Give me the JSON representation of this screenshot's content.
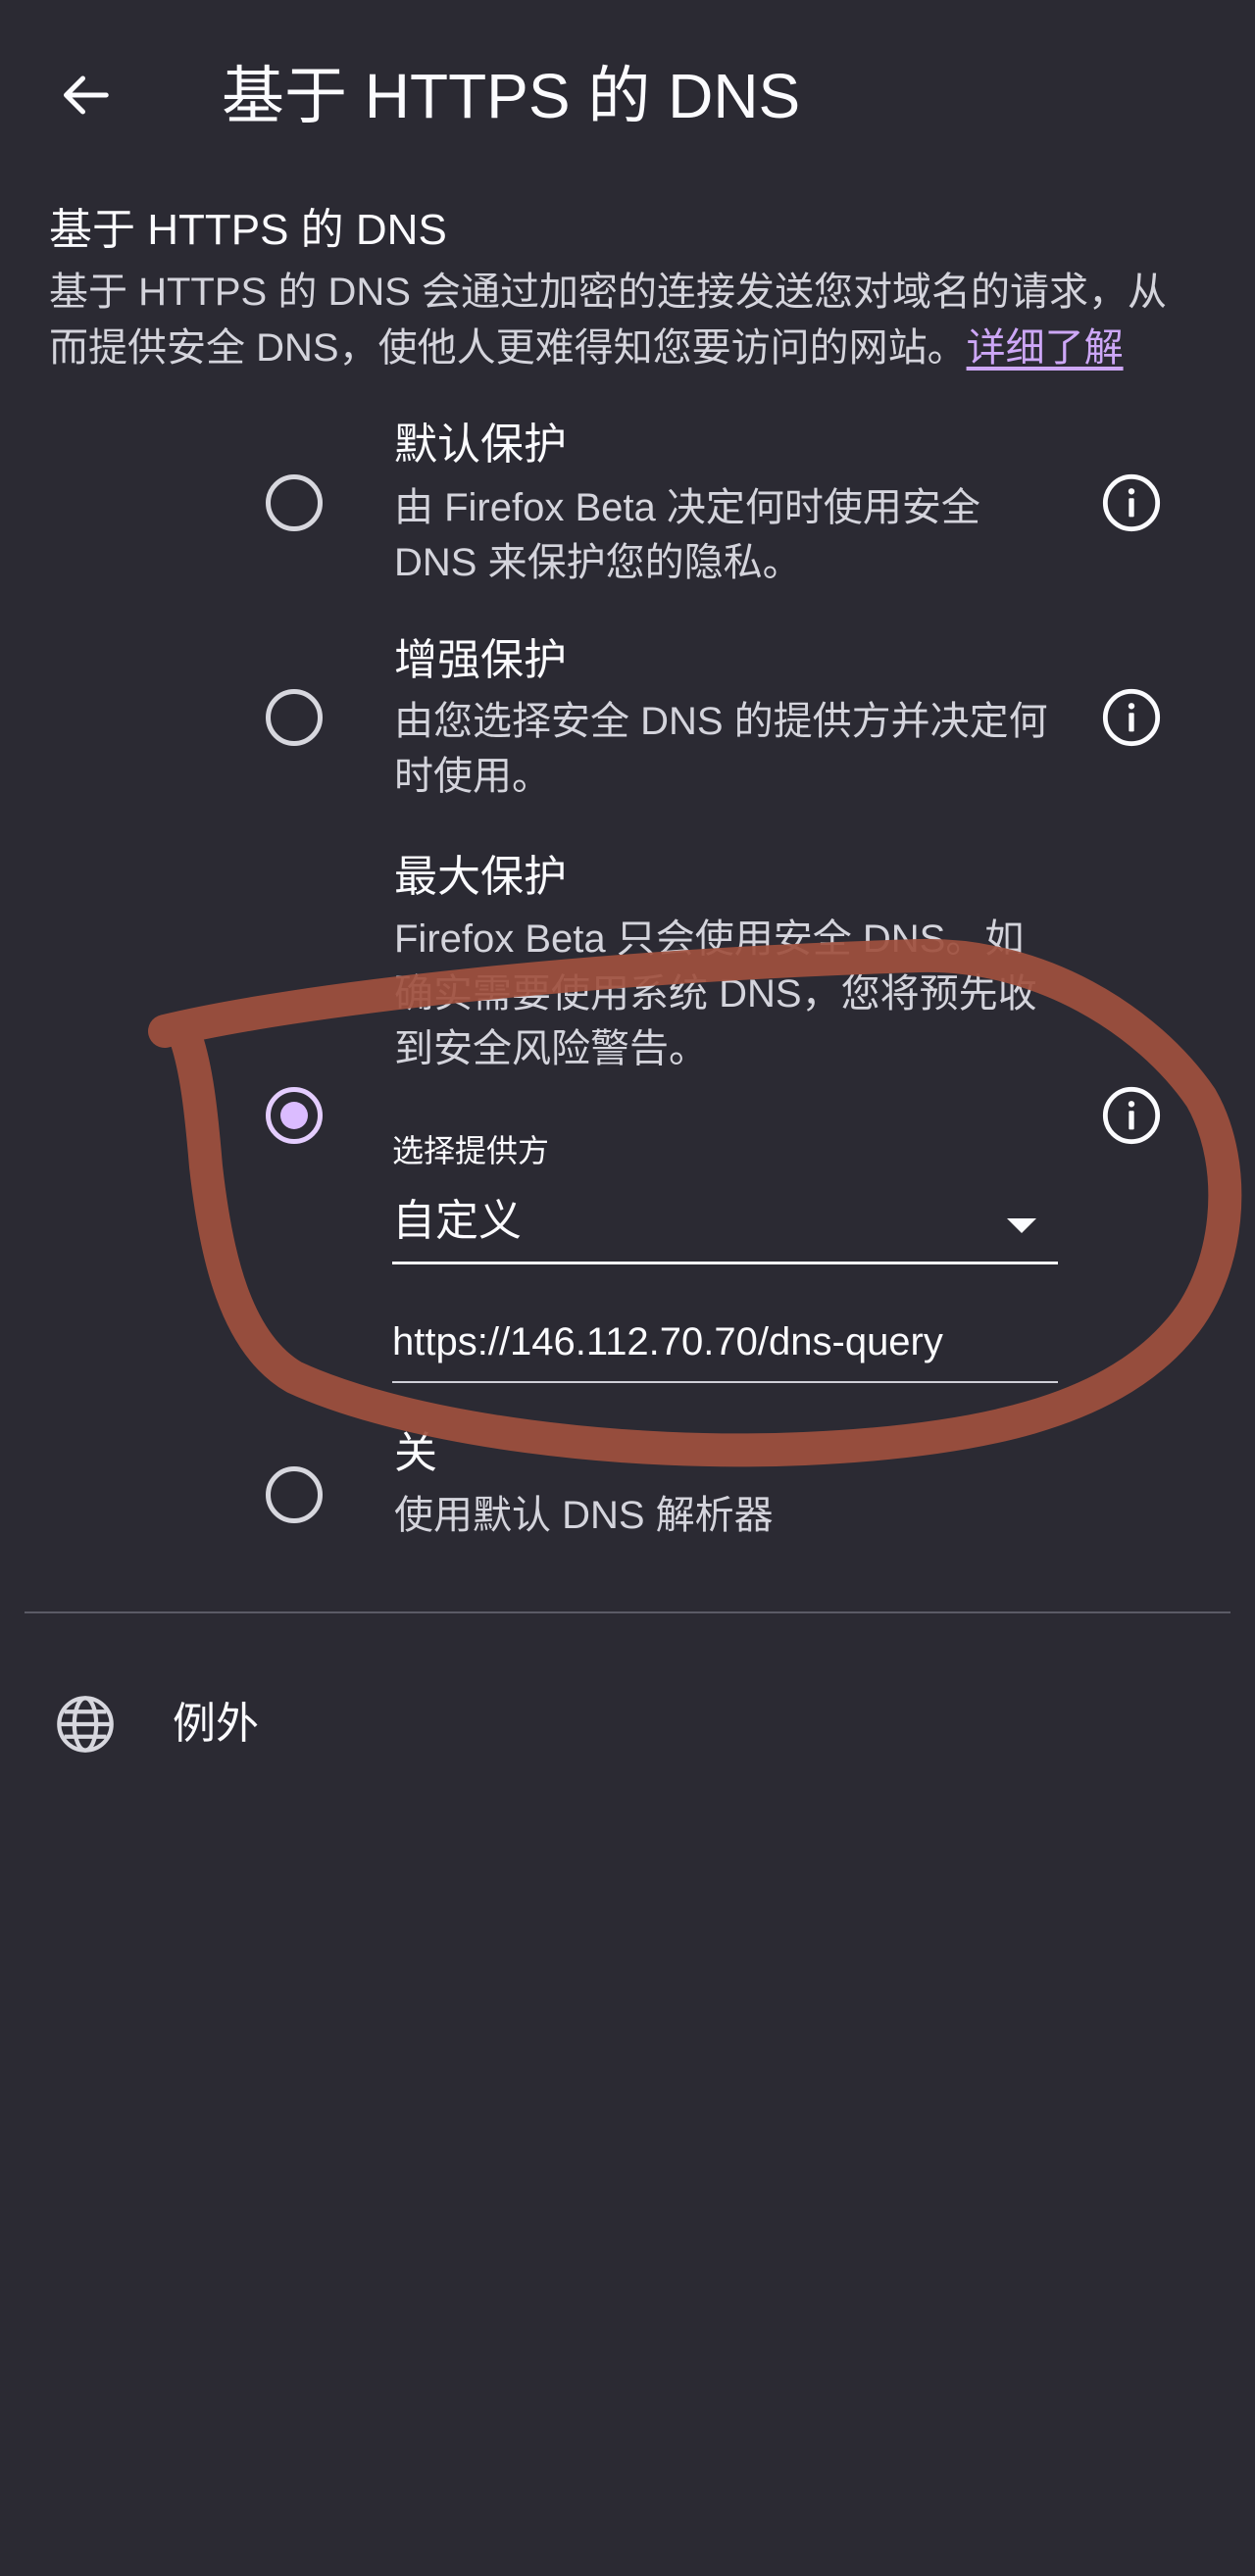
{
  "header": {
    "title": "基于 HTTPS 的 DNS",
    "back_icon": "back-arrow-icon"
  },
  "section": {
    "heading": "基于 HTTPS 的 DNS",
    "description": "基于 HTTPS 的 DNS 会通过加密的连接发送您对域名的请求，从而提供安全 DNS，使他人更难得知您要访问的网站。",
    "learn_more": "详细了解"
  },
  "options": [
    {
      "title": "默认保护",
      "description": "由 Firefox Beta 决定何时使用安全 DNS 来保护您的隐私。",
      "selected": false,
      "info_icon": "info-icon"
    },
    {
      "title": "增强保护",
      "description": "由您选择安全 DNS 的提供方并决定何时使用。",
      "selected": false,
      "info_icon": "info-icon"
    },
    {
      "title": "最大保护",
      "description": "Firefox Beta 只会使用安全 DNS。如确实需要使用系统 DNS，您将预先收到安全风险警告。",
      "selected": true,
      "info_icon": "info-icon",
      "provider_label": "选择提供方",
      "provider_value": "自定义",
      "custom_url": "https://146.112.70.70/dns-query"
    },
    {
      "title": "关",
      "description": "使用默认 DNS 解析器",
      "selected": false
    }
  ],
  "exceptions": {
    "label": "例外",
    "icon": "globe-icon"
  },
  "colors": {
    "background": "#2b2a33",
    "text": "#fbfbfe",
    "secondary_text": "#d4d4dc",
    "link": "#cda7f7",
    "radio_selected": "#dbbcff",
    "annotation": "#a0503e"
  }
}
